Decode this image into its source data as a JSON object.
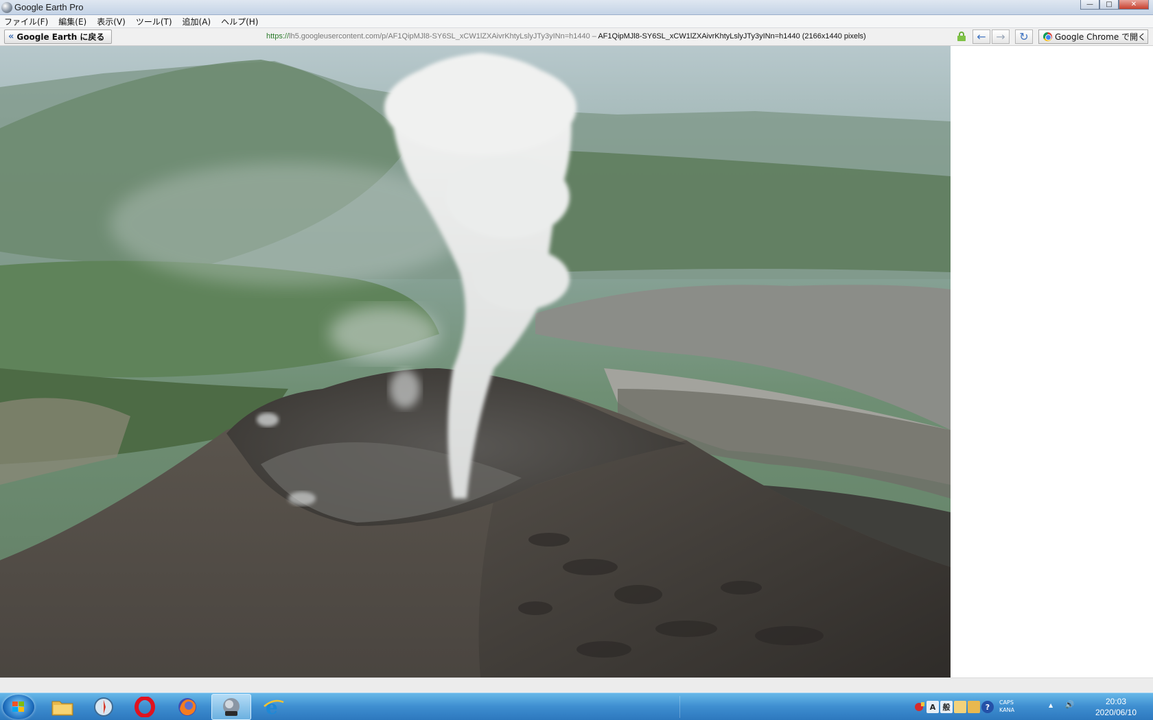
{
  "window": {
    "title": "Google Earth Pro",
    "minimize_glyph": "—",
    "maximize_glyph": "□",
    "close_glyph": "✕"
  },
  "menu": [
    {
      "label": "ファイル(F)"
    },
    {
      "label": "編集(E)"
    },
    {
      "label": "表示(V)"
    },
    {
      "label": "ツール(T)"
    },
    {
      "label": "追加(A)"
    },
    {
      "label": "ヘルプ(H)"
    }
  ],
  "nav": {
    "back_chevron": "«",
    "back_label": "Google Earth に戻る",
    "url_scheme": "https://",
    "url_rest": "lh5.googleusercontent.com/p/AF1QipMJl8-SY6SL_xCW1lZXAivrKhtyLslyJTy3yINn=h1440",
    "url_separator": " – ",
    "page_title": "AF1QipMJl8-SY6SL_xCW1lZXAivrKhtyLslyJTy3yINn=h1440 (2166x1440 pixels)",
    "back_arrow": "←",
    "forward_arrow": "→",
    "reload_glyph": "↻",
    "open_in_chrome_label": "Google Chrome で開く"
  },
  "taskbar": {
    "apps": [
      {
        "name": "file-explorer"
      },
      {
        "name": "safari"
      },
      {
        "name": "opera"
      },
      {
        "name": "firefox"
      },
      {
        "name": "google-earth-pro"
      },
      {
        "name": "internet-explorer"
      }
    ],
    "ime_mode": "A",
    "ime_kanji": "般",
    "help_glyph": "?",
    "caps_label": "CAPS",
    "kana_label": "KANA",
    "tray_up": "▲",
    "speaker_glyph": "🔊",
    "time": "20:03",
    "date": "2020/06/10"
  },
  "colors": {
    "taskbar_top": "#66b7e8",
    "taskbar_bottom": "#2d78be",
    "link_green": "#2a7a2a",
    "arrow_blue": "#3f73c1"
  }
}
